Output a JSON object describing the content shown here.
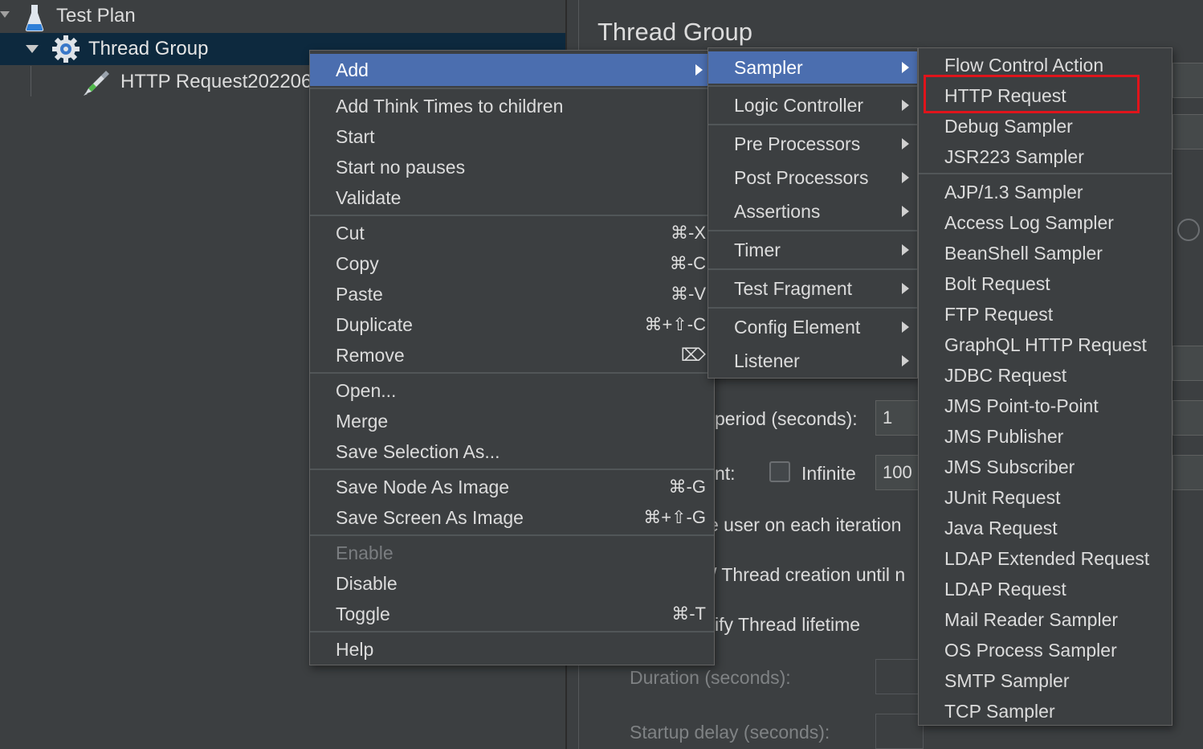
{
  "tree": {
    "items": [
      {
        "label": "Test Plan",
        "icon": "flask-icon"
      },
      {
        "label": "Thread Group",
        "icon": "gear-icon"
      },
      {
        "label": "HTTP Request202206",
        "icon": "pipette-icon"
      }
    ]
  },
  "panel": {
    "title": "Thread Group",
    "ramp_label": "period (seconds):",
    "ramp_value": "1",
    "loop_label": "nt:",
    "infinite_label": "Infinite",
    "loop_value": "100",
    "same_user_label": "e user on each iteration",
    "delay_label": "/ Thread creation until n",
    "lifetime_label": "ify Thread lifetime",
    "duration_label": "Duration (seconds):",
    "startup_label": "Startup delay (seconds):"
  },
  "context_menu": {
    "add": "Add",
    "add_think": "Add Think Times to children",
    "start": "Start",
    "start_no_pauses": "Start no pauses",
    "validate": "Validate",
    "cut": "Cut",
    "cut_sc": "⌘-X",
    "copy": "Copy",
    "copy_sc": "⌘-C",
    "paste": "Paste",
    "paste_sc": "⌘-V",
    "duplicate": "Duplicate",
    "duplicate_sc": "⌘+⇧-C",
    "remove": "Remove",
    "remove_sc": "⌦",
    "open": "Open...",
    "merge": "Merge",
    "save_selection": "Save Selection As...",
    "save_node_image": "Save Node As Image",
    "save_node_image_sc": "⌘-G",
    "save_screen_image": "Save Screen As Image",
    "save_screen_image_sc": "⌘+⇧-G",
    "enable": "Enable",
    "disable": "Disable",
    "toggle": "Toggle",
    "toggle_sc": "⌘-T",
    "help": "Help"
  },
  "add_menu": {
    "sampler": "Sampler",
    "logic_controller": "Logic Controller",
    "pre_processors": "Pre Processors",
    "post_processors": "Post Processors",
    "assertions": "Assertions",
    "timer": "Timer",
    "test_fragment": "Test Fragment",
    "config_element": "Config Element",
    "listener": "Listener"
  },
  "sampler_menu": {
    "items": [
      "Flow Control Action",
      "HTTP Request",
      "Debug Sampler",
      "JSR223 Sampler",
      "AJP/1.3 Sampler",
      "Access Log Sampler",
      "BeanShell Sampler",
      "Bolt Request",
      "FTP Request",
      "GraphQL HTTP Request",
      "JDBC Request",
      "JMS Point-to-Point",
      "JMS Publisher",
      "JMS Subscriber",
      "JUnit Request",
      "Java Request",
      "LDAP Extended Request",
      "LDAP Request",
      "Mail Reader Sampler",
      "OS Process Sampler",
      "SMTP Sampler",
      "TCP Sampler"
    ]
  },
  "colors": {
    "background": "#3c3f41",
    "highlight": "#4b6eaf",
    "tree_selection": "#0d293e",
    "annotation": "#e0141b"
  }
}
